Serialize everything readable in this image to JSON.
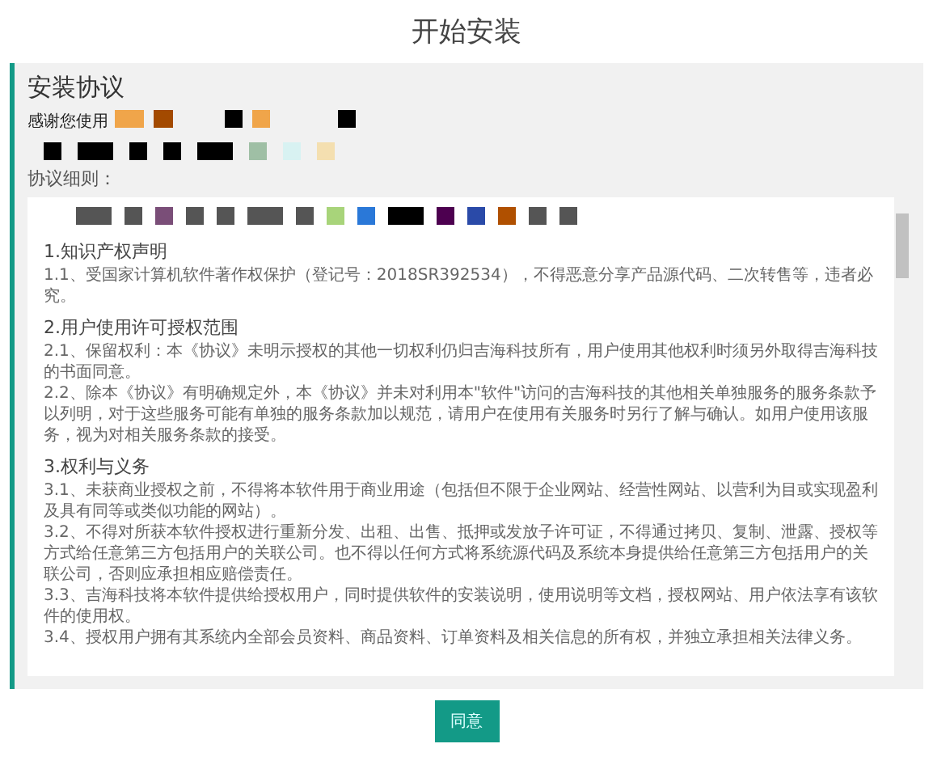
{
  "page_title": "开始安装",
  "panel": {
    "heading": "安装协议",
    "intro": "感谢您使用",
    "details_label": "协议细则："
  },
  "sections": [
    {
      "heading": "1.知识产权声明",
      "paragraphs": [
        "1.1、受国家计算机软件著作权保护（登记号：2018SR392534），不得恶意分享产品源代码、二次转售等，违者必究。"
      ]
    },
    {
      "heading": "2.用户使用许可授权范围",
      "paragraphs": [
        "2.1、保留权利：本《协议》未明示授权的其他一切权利仍归吉海科技所有，用户使用其他权利时须另外取得吉海科技的书面同意。",
        "2.2、除本《协议》有明确规定外，本《协议》并未对利用本\"软件\"访问的吉海科技的其他相关单独服务的服务条款予以列明，对于这些服务可能有单独的服务条款加以规范，请用户在使用有关服务时另行了解与确认。如用户使用该服务，视为对相关服务条款的接受。"
      ]
    },
    {
      "heading": "3.权利与义务",
      "paragraphs": [
        "3.1、未获商业授权之前，不得将本软件用于商业用途（包括但不限于企业网站、经营性网站、以营利为目或实现盈利及具有同等或类似功能的网站）。",
        "3.2、不得对所获本软件授权进行重新分发、出租、出售、抵押或发放子许可证，不得通过拷贝、复制、泄露、授权等方式给任意第三方包括用户的关联公司。也不得以任何方式将系统源代码及系统本身提供给任意第三方包括用户的关联公司，否则应承担相应赔偿责任。",
        "3.3、吉海科技将本软件提供给授权用户，同时提供软件的安装说明，使用说明等文档，授权网站、用户依法享有该软件的使用权。",
        "3.4、授权用户拥有其系统内全部会员资料、商品资料、订单资料及相关信息的所有权，并独立承担相关法律义务。"
      ]
    }
  ],
  "agree_button": "同意"
}
